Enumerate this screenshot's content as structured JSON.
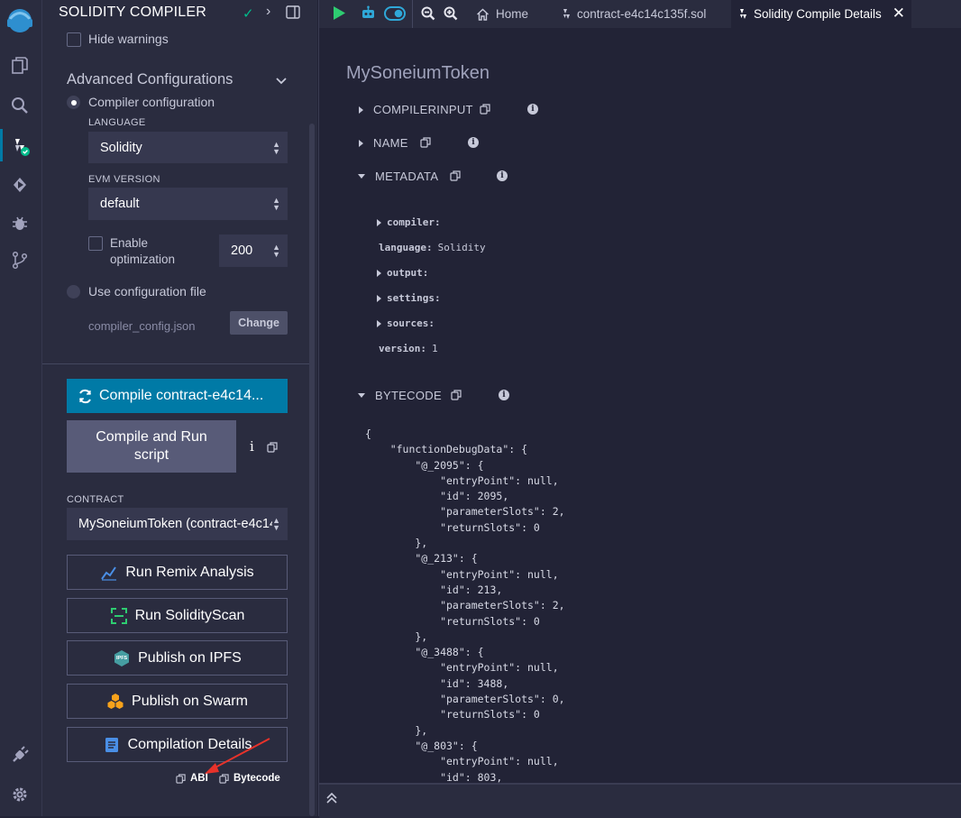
{
  "panel": {
    "title": "SOLIDITY COMPILER",
    "hide_warnings": "Hide warnings",
    "advanced": "Advanced Configurations",
    "compiler_config": "Compiler configuration",
    "language_label": "LANGUAGE",
    "language_value": "Solidity",
    "evm_label": "EVM VERSION",
    "evm_value": "default",
    "enable_opt_1": "Enable",
    "enable_opt_2": "optimization",
    "runs_value": "200",
    "use_config_file": "Use configuration file",
    "config_file": "compiler_config.json",
    "change_btn": "Change",
    "compile_btn": "Compile contract-e4c14...",
    "compile_run_1": "Compile and Run",
    "compile_run_2": "script",
    "i_glyph": "i",
    "contract_label": "CONTRACT",
    "contract_value": "MySoneiumToken (contract-e4c14",
    "run_remix": "Run Remix Analysis",
    "run_solidityscan": "Run SolidityScan",
    "ipfs_badge": "IPFS",
    "publish_ipfs": "Publish on IPFS",
    "publish_swarm": "Publish on Swarm",
    "compilation_details": "Compilation Details",
    "abi": "ABI",
    "bytecode": "Bytecode"
  },
  "tabs": {
    "home": "Home",
    "file": "contract-e4c14c135f.sol",
    "details": "Solidity Compile Details"
  },
  "content": {
    "title": "MySoneiumToken",
    "sections": {
      "compilerinput": "COMPILERINPUT",
      "name": "NAME",
      "metadata": "METADATA",
      "bytecode": "BYTECODE"
    },
    "metadata": {
      "compiler": "compiler:",
      "language_k": "language:",
      "language_v": "Solidity",
      "output": "output:",
      "settings": "settings:",
      "sources": "sources:",
      "version_k": "version:",
      "version_v": "1"
    },
    "bytecode_text": "{\n    \"functionDebugData\": {\n        \"@_2095\": {\n            \"entryPoint\": null,\n            \"id\": 2095,\n            \"parameterSlots\": 2,\n            \"returnSlots\": 0\n        },\n        \"@_213\": {\n            \"entryPoint\": null,\n            \"id\": 213,\n            \"parameterSlots\": 2,\n            \"returnSlots\": 0\n        },\n        \"@_3488\": {\n            \"entryPoint\": null,\n            \"id\": 3488,\n            \"parameterSlots\": 0,\n            \"returnSlots\": 0\n        },\n        \"@_803\": {\n            \"entryPoint\": null,\n            \"id\": 803,"
  },
  "colors": {
    "accent": "#007aa6",
    "success": "#00bc8c",
    "annotation_arrow": "#e8322a"
  }
}
